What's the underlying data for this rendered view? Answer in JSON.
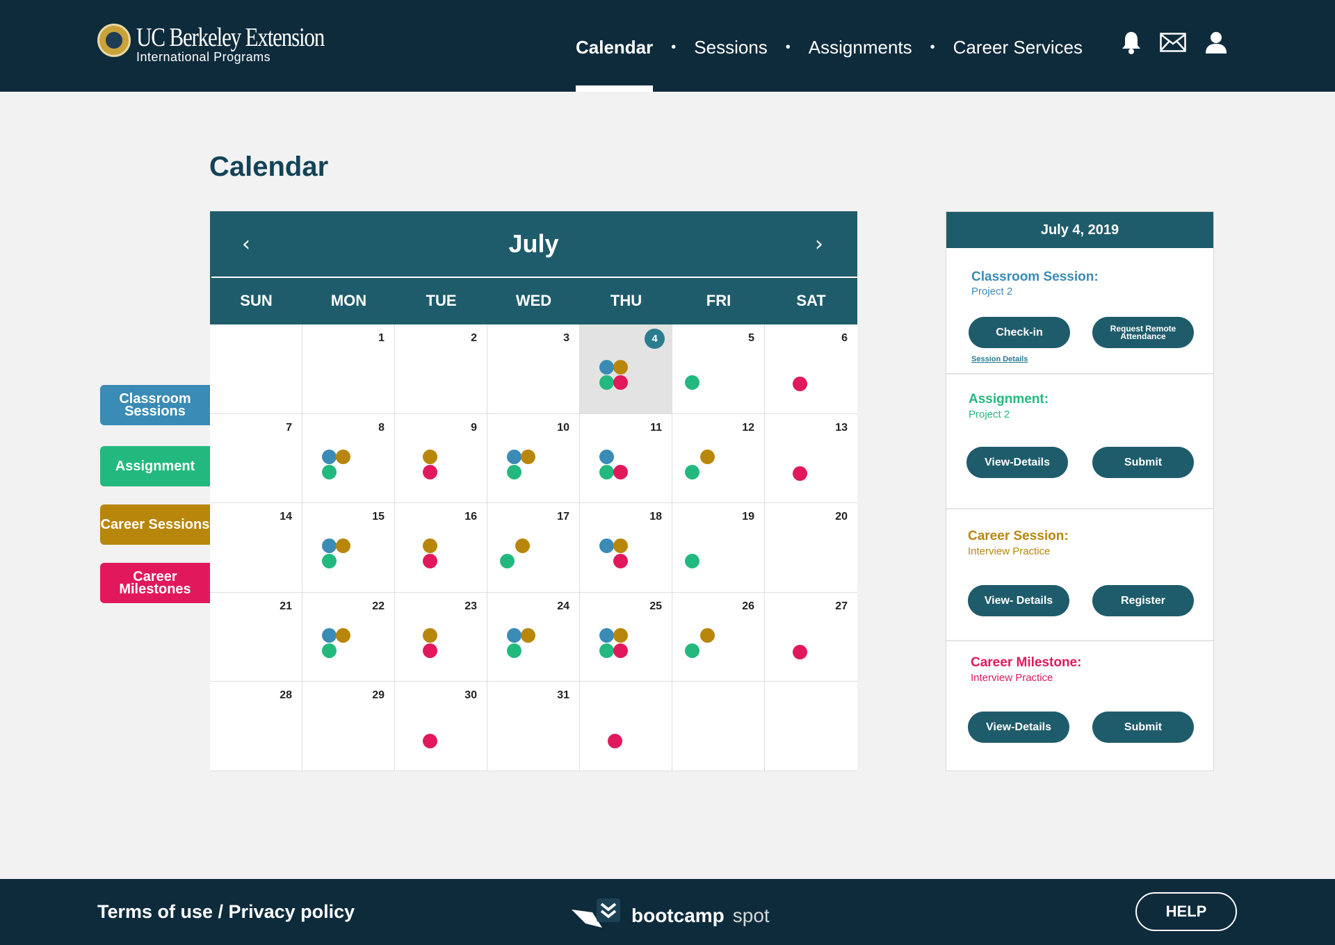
{
  "header": {
    "logo_title": "UC Berkeley Extension",
    "logo_subtitle": "International Programs",
    "nav": [
      {
        "label": "Calendar",
        "active": true
      },
      {
        "label": "Sessions",
        "active": false
      },
      {
        "label": "Assignments",
        "active": false
      },
      {
        "label": "Career Services",
        "active": false
      }
    ],
    "icons": [
      "bell-icon",
      "mail-icon",
      "user-icon"
    ]
  },
  "page_title": "Calendar",
  "legend": [
    {
      "label": "Classroom Sessions",
      "color": "#3a8bb5",
      "key": "classroom"
    },
    {
      "label": "Assignment",
      "color": "#23b97e",
      "key": "assignment"
    },
    {
      "label": "Career Sessions",
      "color": "#b8860b",
      "key": "career"
    },
    {
      "label": "Career Milestones",
      "color": "#e1185c",
      "key": "milestone"
    }
  ],
  "calendar": {
    "month": "July",
    "prev_icon": "‹",
    "next_icon": "›",
    "weekdays": [
      "SUN",
      "MON",
      "TUE",
      "WED",
      "THU",
      "FRI",
      "SAT"
    ],
    "selected_day": "4",
    "days": [
      {
        "day": "",
        "events": []
      },
      {
        "day": "1",
        "events": []
      },
      {
        "day": "2",
        "events": []
      },
      {
        "day": "3",
        "events": []
      },
      {
        "day": "4",
        "events": [
          "classroom",
          "career",
          "assignment",
          "milestone"
        ]
      },
      {
        "day": "5",
        "events": [
          "assignment"
        ]
      },
      {
        "day": "6",
        "events": [
          "milestone"
        ]
      },
      {
        "day": "7",
        "events": []
      },
      {
        "day": "8",
        "events": [
          "classroom",
          "career",
          "assignment"
        ]
      },
      {
        "day": "9",
        "events": [
          "career",
          "milestone"
        ]
      },
      {
        "day": "10",
        "events": [
          "classroom",
          "career",
          "assignment"
        ]
      },
      {
        "day": "11",
        "events": [
          "classroom",
          "assignment",
          "milestone"
        ]
      },
      {
        "day": "12",
        "events": [
          "career",
          "assignment"
        ]
      },
      {
        "day": "13",
        "events": [
          "milestone"
        ]
      },
      {
        "day": "14",
        "events": []
      },
      {
        "day": "15",
        "events": [
          "classroom",
          "career",
          "assignment"
        ]
      },
      {
        "day": "16",
        "events": [
          "career",
          "milestone"
        ]
      },
      {
        "day": "17",
        "events": [
          "career",
          "assignment"
        ]
      },
      {
        "day": "18",
        "events": [
          "classroom",
          "career",
          "milestone"
        ]
      },
      {
        "day": "19",
        "events": [
          "assignment"
        ]
      },
      {
        "day": "20",
        "events": []
      },
      {
        "day": "21",
        "events": []
      },
      {
        "day": "22",
        "events": [
          "classroom",
          "career",
          "assignment"
        ]
      },
      {
        "day": "23",
        "events": [
          "career",
          "milestone"
        ]
      },
      {
        "day": "24",
        "events": [
          "classroom",
          "career",
          "assignment"
        ]
      },
      {
        "day": "25",
        "events": [
          "classroom",
          "career",
          "assignment",
          "milestone"
        ]
      },
      {
        "day": "26",
        "events": [
          "career",
          "assignment"
        ]
      },
      {
        "day": "27",
        "events": [
          "milestone"
        ]
      },
      {
        "day": "28",
        "events": []
      },
      {
        "day": "29",
        "events": []
      },
      {
        "day": "30",
        "events": [
          "milestone"
        ]
      },
      {
        "day": "31",
        "events": []
      },
      {
        "day": "",
        "events": [
          "milestone"
        ]
      },
      {
        "day": "",
        "events": []
      },
      {
        "day": "",
        "events": []
      }
    ]
  },
  "panel": {
    "date": "July 4, 2019",
    "events": [
      {
        "title": "Classroom Session:",
        "subtitle": "Project 2",
        "color": "#3a8bb5",
        "buttons": [
          "Check-in",
          "Request Remote Attendance"
        ],
        "link": "Session Details"
      },
      {
        "title": "Assignment:",
        "subtitle": "Project 2",
        "color": "#23b97e",
        "buttons": [
          "View-Details",
          "Submit"
        ]
      },
      {
        "title": "Career Session:",
        "subtitle": "Interview Practice",
        "color": "#b8860b",
        "buttons": [
          "View- Details",
          "Register"
        ]
      },
      {
        "title": "Career Milestone:",
        "subtitle": "Interview Practice",
        "color": "#e1185c",
        "buttons": [
          "View-Details",
          "Submit"
        ]
      }
    ]
  },
  "footer": {
    "terms": "Terms of use / Privacy policy",
    "brand_name": "bootcamp",
    "brand_suffix": "spot",
    "help": "HELP"
  }
}
